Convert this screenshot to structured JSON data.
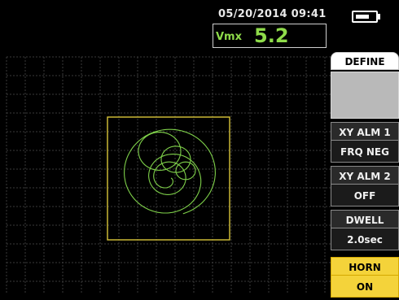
{
  "status": {
    "datetime": "05/20/2014  09:41",
    "battery_level": 0.72
  },
  "readout": {
    "label": "Vmx",
    "value": "5.2"
  },
  "menu": {
    "title": "DEFINE",
    "xy_alm1": {
      "label": "XY ALM 1",
      "value": "FRQ NEG"
    },
    "xy_alm2": {
      "label": "XY ALM 2",
      "value": "OFF"
    },
    "dwell": {
      "label": "DWELL",
      "value": "2.0sec"
    },
    "horn": {
      "label": "HORN",
      "value": "ON"
    }
  },
  "colors": {
    "grid": "#3a3a3a",
    "alarm_box": "#d9c53a",
    "signal": "#7fd14a",
    "accent": "#f4d33a",
    "readout": "#8fdc4a"
  }
}
